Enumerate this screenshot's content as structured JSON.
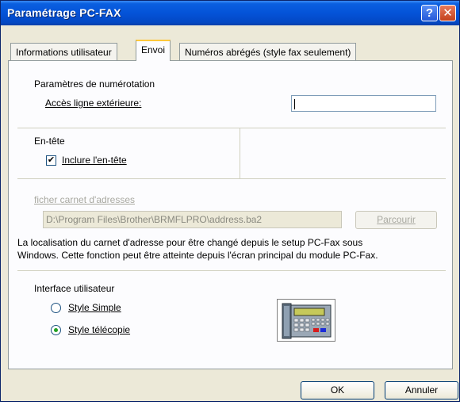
{
  "window": {
    "title": "Paramétrage PC-FAX",
    "help_label": "?",
    "close_label": "✕"
  },
  "tabs": [
    {
      "label": "Informations utilisateur"
    },
    {
      "label": "Envoi"
    },
    {
      "label": "Numéros abrégés (style fax seulement)"
    }
  ],
  "dial": {
    "group_label": "Paramètres de numérotation",
    "access_label": "Accès ligne extérieure:",
    "access_value": ""
  },
  "header": {
    "group_label": "En-tête",
    "include_label": "Inclure l'en-tête",
    "include_checked": true,
    "check_glyph": "✔"
  },
  "addressbook": {
    "group_label": "ficher carnet d'adresses",
    "path_value": "D:\\Program Files\\Brother\\BRMFLPRO\\address.ba2",
    "browse_label": "Parcourir",
    "note_line1": "La localisation du carnet d'adresse pour être changé depuis le setup PC-Fax sous",
    "note_line2": "Windows. Cette fonction peut être atteinte depuis l'écran principal du module PC-Fax."
  },
  "interface": {
    "group_label": "Interface utilisateur",
    "options": [
      {
        "label": "Style Simple",
        "selected": false
      },
      {
        "label": "Style télécopie",
        "selected": true
      }
    ],
    "image_icon": "fax-machine-icon"
  },
  "buttons": {
    "ok_label": "OK",
    "cancel_label": "Annuler"
  }
}
